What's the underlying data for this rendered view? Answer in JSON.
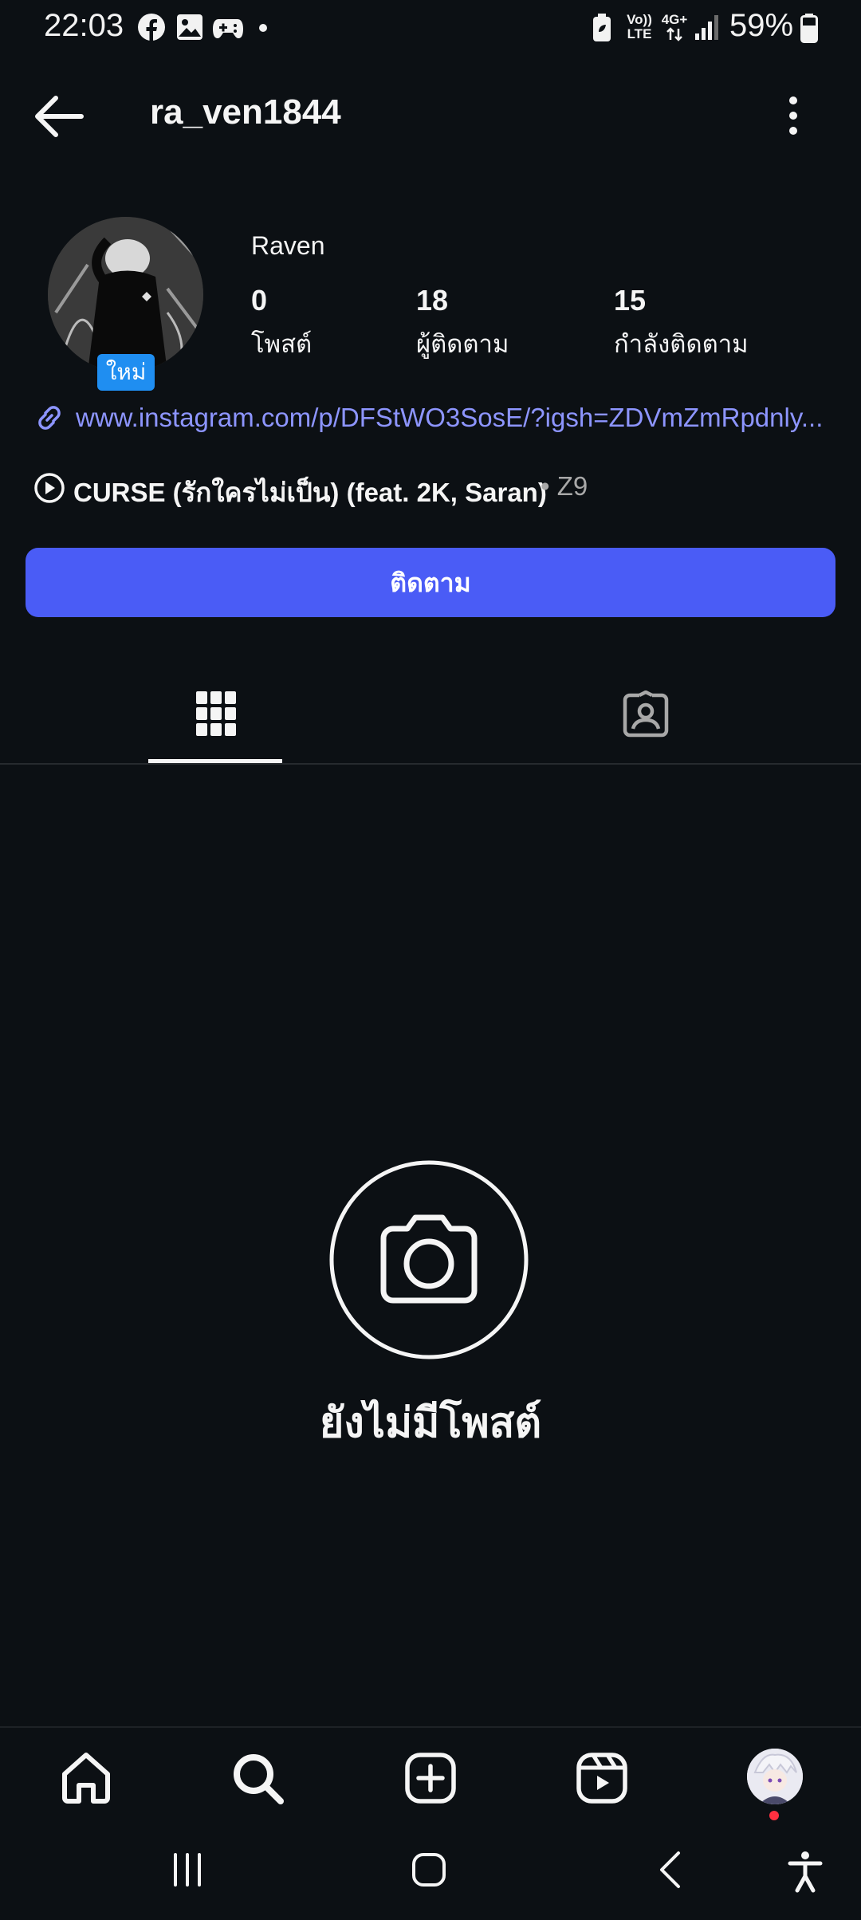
{
  "status_bar": {
    "time": "22:03",
    "battery": "59%",
    "icons": [
      "facebook-icon",
      "gallery-icon",
      "game-controller-icon",
      "dot-icon",
      "battery-saver-icon",
      "volte-icon",
      "4g-icon",
      "signal-icon",
      "battery-icon"
    ],
    "volte_top": "Vo))",
    "volte_bottom": "LTE",
    "network": "4G+"
  },
  "header": {
    "username": "ra_ven1844",
    "back_icon": "arrow-left-icon",
    "more_icon": "more-vertical-icon"
  },
  "profile": {
    "new_badge": "ใหม่",
    "display_name": "Raven",
    "stats": [
      {
        "value": "0",
        "label": "โพสต์"
      },
      {
        "value": "18",
        "label": "ผู้ติดตาม"
      },
      {
        "value": "15",
        "label": "กำลังติดตาม"
      }
    ],
    "link": "www.instagram.com/p/DFStWO3SosE/?igsh=ZDVmZmRpdnly...",
    "music": {
      "title": "CURSE (รักใครไม่เป็น) (feat. 2K, Saran)",
      "artist": "• Z9"
    },
    "follow_label": "ติดตาม"
  },
  "tabs": [
    {
      "icon": "grid-icon",
      "active": true
    },
    {
      "icon": "tagged-person-icon",
      "active": false
    }
  ],
  "empty_state": {
    "icon": "camera-icon",
    "text": "ยังไม่มีโพสต์"
  },
  "bottom_nav": [
    "home-icon",
    "search-icon",
    "create-icon",
    "reels-icon",
    "profile-avatar"
  ],
  "system_nav": [
    "recent-apps-icon",
    "home-button-icon",
    "back-button-icon",
    "accessibility-icon"
  ],
  "colors": {
    "background": "#0c1014",
    "accent": "#4a5cf6",
    "link": "#8d95ff",
    "badge": "#1f8ef1",
    "notification_dot": "#ff3040"
  }
}
